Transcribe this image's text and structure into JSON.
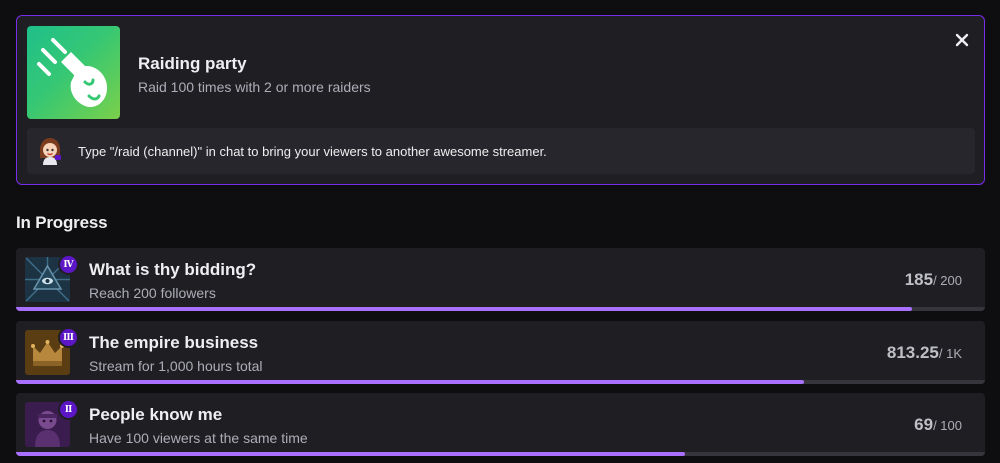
{
  "featured": {
    "title": "Raiding party",
    "description": "Raid 100 times with 2 or more raiders",
    "tip": "Type \"/raid (channel)\" in chat to bring your viewers to another awesome streamer.",
    "badge_icon": "raid-hand-icon",
    "close_icon": "close-icon",
    "accent_color": "#772ce8"
  },
  "in_progress": {
    "heading": "In Progress",
    "items": [
      {
        "title": "What is thy bidding?",
        "description": "Reach 200 followers",
        "tier": "Ⅳ",
        "current": "185",
        "total": "/ 200",
        "progress": 0.925,
        "icon": "eye-pyramid-icon"
      },
      {
        "title": "The empire business",
        "description": "Stream for 1,000 hours total",
        "tier": "Ⅲ",
        "current": "813.25",
        "total": "/ 1K",
        "progress": 0.813,
        "icon": "crown-icon"
      },
      {
        "title": "People know me",
        "description": "Have 100 viewers at the same time",
        "tier": "Ⅱ",
        "current": "69",
        "total": "/ 100",
        "progress": 0.69,
        "icon": "person-icon"
      }
    ],
    "progress_color": "#a970ff"
  }
}
